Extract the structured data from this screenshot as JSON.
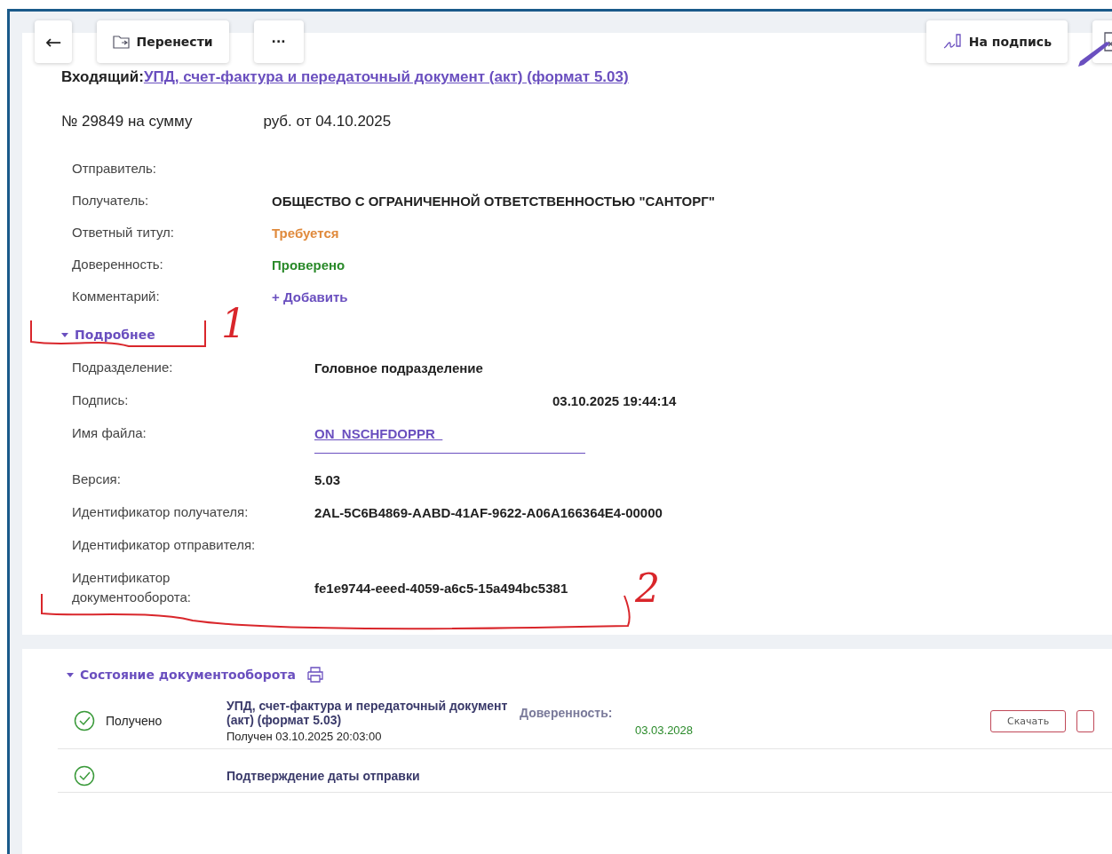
{
  "toolbar": {
    "back": "←",
    "buttons": [
      {
        "kind": "move",
        "label": "Перенести"
      },
      {
        "kind": "more",
        "label": "···"
      }
    ],
    "sign_button": "На подпись"
  },
  "document": {
    "direction": "Входящий:",
    "title": "УПД, счет-фактура и передаточный документ (акт) (формат 5.03)",
    "number": "№ 29849 на сумму",
    "sum_suffix": "руб. от 04.10.2025"
  },
  "fields": [
    {
      "label": "Отправитель:"
    },
    {
      "label": "Получатель:",
      "value": "ОБЩЕСТВО С ОГРАНИЧЕННОЙ ОТВЕТСТВЕННОСТЬЮ \"САНТОРГ\"",
      "kind": "text"
    },
    {
      "label": "Ответный титул:",
      "value": "Требуется",
      "kind": "warning"
    },
    {
      "label": "Доверенность:",
      "value": "Проверено",
      "kind": "success"
    },
    {
      "label": "Комментарий:",
      "value": "+ Добавить",
      "kind": "action"
    }
  ],
  "details": {
    "toggle": "Подробнее",
    "expanded": true,
    "fields": [
      {
        "label": "Подразделение:",
        "value": "Головное подразделение",
        "kind": "text"
      },
      {
        "label": "Подпись:",
        "value": "03.10.2025 19:44:14",
        "kind": "redacted"
      },
      {
        "label": "Имя файла:",
        "value": "ON_NSCHFDOPPR_",
        "kind": "link"
      },
      {
        "label": "Версия:",
        "value": "5.03",
        "kind": "text"
      },
      {
        "label": "Идентификатор получателя:",
        "value": "2AL-5C6B4869-AABD-41AF-9622-A06A166364E4-00000",
        "kind": "text"
      },
      {
        "label": "Идентификатор отправителя:"
      },
      {
        "label": "Идентификатор документооборота:",
        "value": "fe1e9744-eeed-4059-a6c5-15a494bc5381",
        "kind": "text"
      }
    ]
  },
  "annotations": [
    {
      "label": "1"
    },
    {
      "label": "2"
    }
  ],
  "workflow": {
    "title": "Состояние документооборота",
    "expanded": true,
    "rows": [
      {
        "status": "Получено",
        "title": "УПД, счет-фактура и передаточный документ (акт) (формат 5.03)",
        "subtitle": "Получен 03.10.2025 20:03:00",
        "attr_label": "Доверенность:",
        "attr_value": "03.03.2028",
        "button": "Скачать"
      },
      {
        "title": "Подтверждение даты отправки"
      }
    ]
  }
}
